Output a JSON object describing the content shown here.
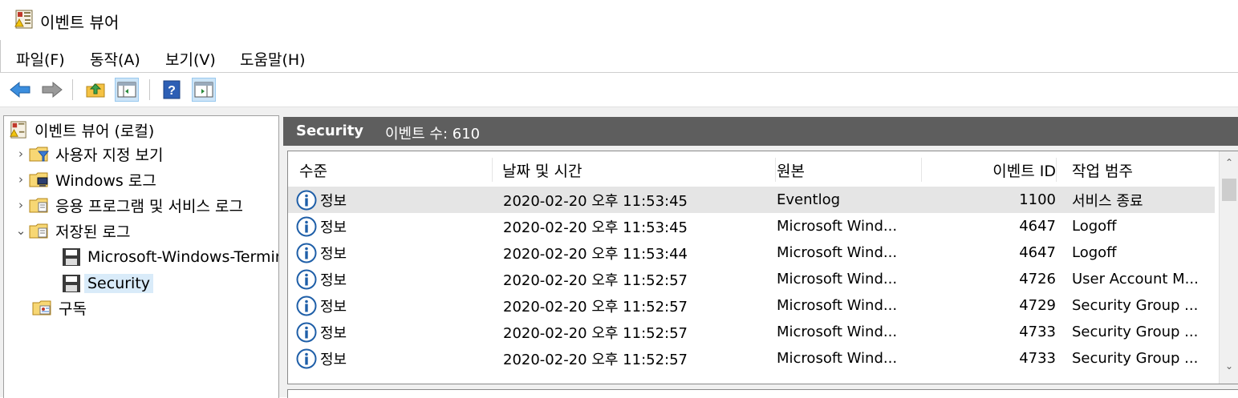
{
  "window": {
    "title": "이벤트 뷰어",
    "icon": "event-viewer-icon"
  },
  "menu": [
    {
      "label": "파일(F)"
    },
    {
      "label": "동작(A)"
    },
    {
      "label": "보기(V)"
    },
    {
      "label": "도움말(H)"
    }
  ],
  "toolbar": {
    "buttons": [
      "back-arrow-icon",
      "forward-arrow-icon",
      "up-folder-icon",
      "show-hide-console-tree-icon",
      "help-icon",
      "show-hide-action-pane-icon"
    ]
  },
  "tree": {
    "items": [
      {
        "label": "이벤트 뷰어 (로컬)",
        "icon": "event-viewer-icon"
      },
      {
        "label": "사용자 지정 보기",
        "icon": "folder-filter-icon",
        "expander": "collapsed"
      },
      {
        "label": "Windows 로그",
        "icon": "folder-computer-icon",
        "expander": "collapsed"
      },
      {
        "label": "응용 프로그램 및 서비스 로그",
        "icon": "folder-log-icon",
        "expander": "collapsed"
      },
      {
        "label": "저장된 로그",
        "icon": "folder-log-icon",
        "expander": "expanded"
      },
      {
        "label": "Microsoft-Windows-TerminalServices",
        "icon": "floppy-disk-icon"
      },
      {
        "label": "Security",
        "icon": "floppy-disk-icon",
        "selected": true
      },
      {
        "label": "구독",
        "icon": "subscription-icon"
      }
    ]
  },
  "right_header": {
    "log_name": "Security",
    "event_count": "이벤트 수: 610"
  },
  "grid": {
    "columns": [
      "수준",
      "날짜 및 시간",
      "원본",
      "이벤트 ID",
      "작업 범주"
    ],
    "rows": [
      {
        "level": "정보",
        "datetime": "2020-02-20 오후 11:53:45",
        "source": "Eventlog",
        "event_id": "1100",
        "category": "서비스 종료"
      },
      {
        "level": "정보",
        "datetime": "2020-02-20 오후 11:53:45",
        "source": "Microsoft Wind...",
        "event_id": "4647",
        "category": "Logoff"
      },
      {
        "level": "정보",
        "datetime": "2020-02-20 오후 11:53:44",
        "source": "Microsoft Wind...",
        "event_id": "4647",
        "category": "Logoff"
      },
      {
        "level": "정보",
        "datetime": "2020-02-20 오후 11:52:57",
        "source": "Microsoft Wind...",
        "event_id": "4726",
        "category": "User Account M..."
      },
      {
        "level": "정보",
        "datetime": "2020-02-20 오후 11:52:57",
        "source": "Microsoft Wind...",
        "event_id": "4729",
        "category": "Security Group ..."
      },
      {
        "level": "정보",
        "datetime": "2020-02-20 오후 11:52:57",
        "source": "Microsoft Wind...",
        "event_id": "4733",
        "category": "Security Group ..."
      },
      {
        "level": "정보",
        "datetime": "2020-02-20 오후 11:52:57",
        "source": "Microsoft Wind...",
        "event_id": "4733",
        "category": "Security Group ..."
      }
    ]
  },
  "colors": {
    "header_bg": "#5e5e5e",
    "selection": "#d9ebf9",
    "info_icon": "#1f5fa8"
  }
}
